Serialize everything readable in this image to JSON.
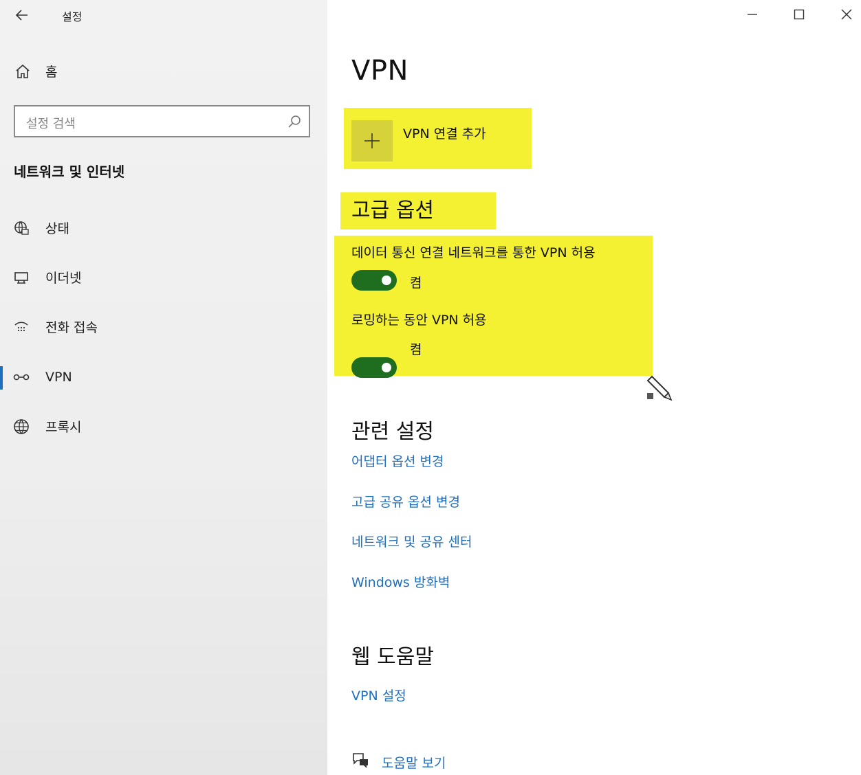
{
  "window": {
    "title": "설정",
    "back_icon": "arrow-left-icon",
    "controls": [
      "minimize-icon",
      "maximize-icon",
      "close-icon"
    ]
  },
  "sidebar": {
    "home_label": "홈",
    "search_placeholder": "설정 검색",
    "section_title": "네트워크 및 인터넷",
    "items": [
      {
        "label": "상태",
        "icon": "globe-status-icon"
      },
      {
        "label": "이더넷",
        "icon": "ethernet-icon"
      },
      {
        "label": "전화 접속",
        "icon": "dial-up-icon"
      },
      {
        "label": "VPN",
        "icon": "vpn-icon",
        "selected": true
      },
      {
        "label": "프록시",
        "icon": "globe-icon"
      }
    ]
  },
  "main": {
    "title": "VPN",
    "add_connection_label": "VPN 연결 추가",
    "advanced": {
      "heading": "고급 옵션",
      "options": [
        {
          "label": "데이터 통신 연결 네트워크를 통한 VPN 허용",
          "state": "켬",
          "on": true
        },
        {
          "label": "로밍하는 동안 VPN 허용",
          "state": "켬",
          "on": true
        }
      ]
    },
    "related": {
      "heading": "관련 설정",
      "links": [
        "어댑터 옵션 변경",
        "고급 공유 옵션 변경",
        "네트워크 및 공유 센터",
        "Windows 방화벽"
      ]
    },
    "web_help": {
      "heading": "웹 도움말",
      "links": [
        "VPN 설정"
      ]
    },
    "help_link": "도움말 보기"
  },
  "colors": {
    "highlight": "#f4f032",
    "toggle_on": "#1f6e1f",
    "link": "#1f6fbf"
  }
}
